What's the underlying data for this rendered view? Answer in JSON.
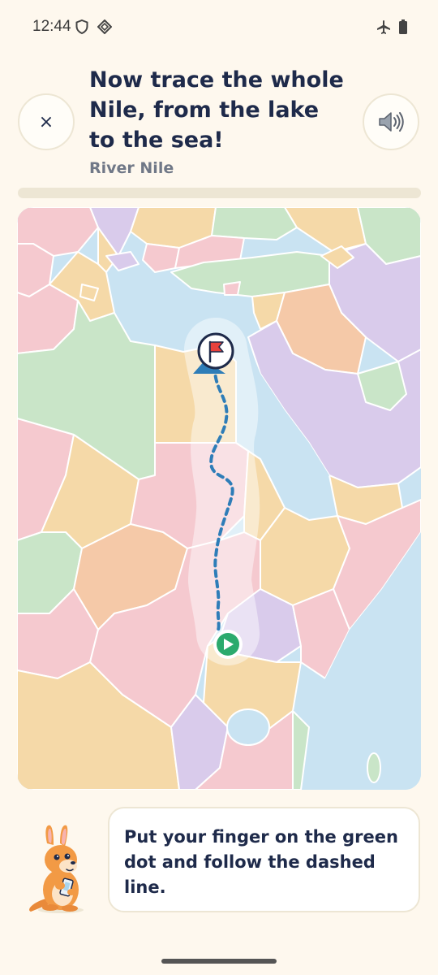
{
  "status_bar": {
    "time": "12:44"
  },
  "header": {
    "title": "Now trace the whole Nile, from the lake to the sea!",
    "subtitle": "River Nile",
    "close_label": "×",
    "progress": 0.0
  },
  "hint": {
    "text": "Put your finger on the green dot and follow the dashed line."
  },
  "colors": {
    "background": "#FEF8EE",
    "water": "#C9E3F2",
    "path": "#2E7DB8",
    "start_dot": "#2BAA6D",
    "flag": "#E8413C",
    "text": "#1E2A4A"
  },
  "icons": [
    "close-icon",
    "speaker-icon",
    "flag-icon",
    "play-icon",
    "shield-icon",
    "vpn-icon",
    "airplane-icon",
    "battery-icon",
    "kangaroo-mascot"
  ]
}
